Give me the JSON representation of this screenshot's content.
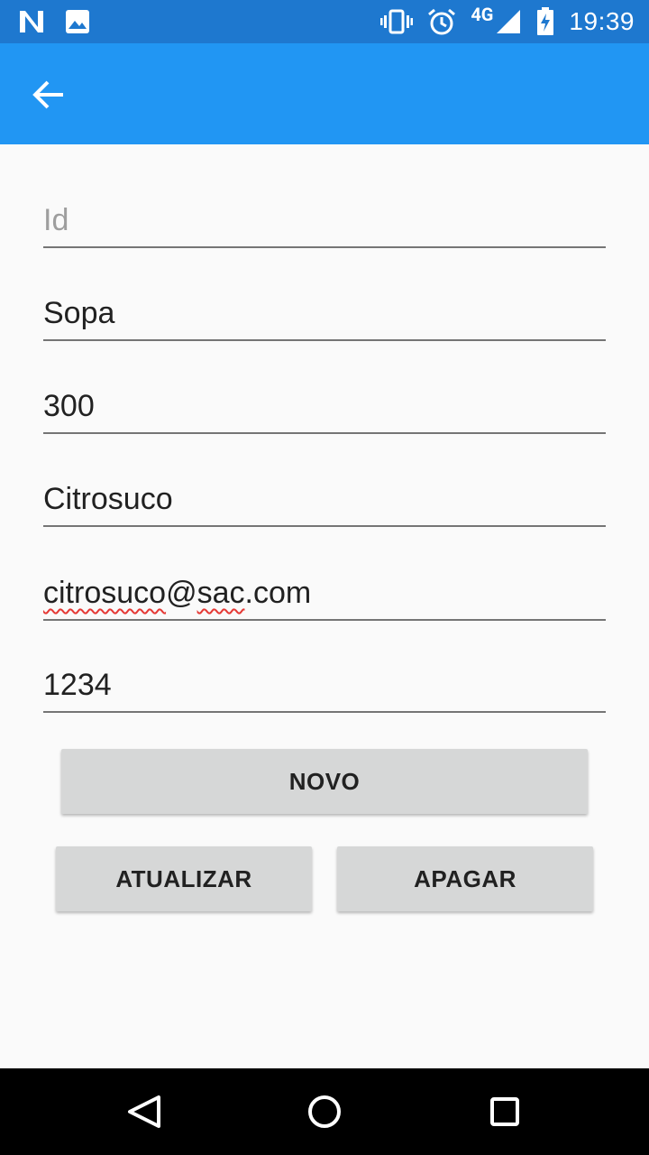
{
  "status_bar": {
    "time": "19:39",
    "network": "4G",
    "left_icons": [
      "n-notification-icon",
      "image-notification-icon"
    ],
    "right_icons": [
      "vibrate-icon",
      "alarm-icon",
      "signal-icon",
      "battery-charging-icon"
    ]
  },
  "app_bar": {
    "back_icon": "arrow-back-icon"
  },
  "form": {
    "id": {
      "placeholder": "Id",
      "value": ""
    },
    "name": {
      "value": "Sopa"
    },
    "quantity": {
      "value": "300"
    },
    "company": {
      "value": "Citrosuco"
    },
    "email": {
      "part1": "citrosuco",
      "at": "@",
      "part2": "sac",
      "part3": ".com"
    },
    "phone": {
      "value": "1234"
    }
  },
  "buttons": {
    "novo": "NOVO",
    "atualizar": "ATUALIZAR",
    "apagar": "APAGAR"
  },
  "nav_bar": {
    "icons": [
      "back-triangle-icon",
      "home-circle-icon",
      "recents-square-icon"
    ]
  },
  "colors": {
    "status_bar": "#1E78CF",
    "app_bar": "#2196F3",
    "background": "#FAFAFA",
    "button": "#D6D7D7"
  }
}
